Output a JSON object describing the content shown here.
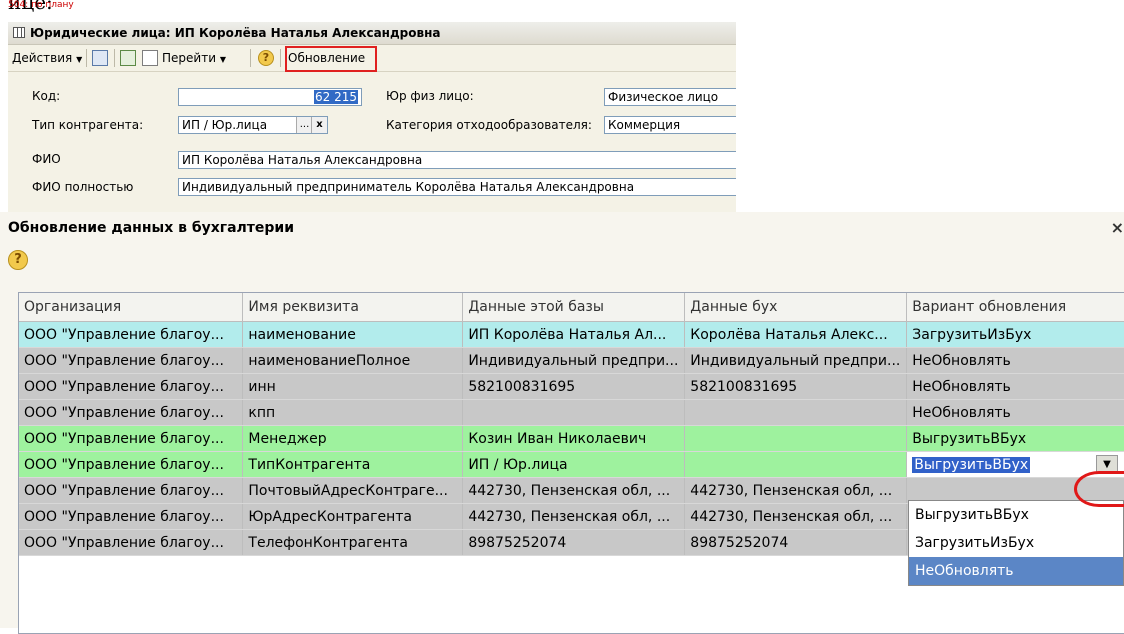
{
  "top": {
    "cropped_text": "ице:",
    "red_text": "504: по плану"
  },
  "window1": {
    "title": "Юридические лица: ИП Королёва Наталья Александровна",
    "toolbar": {
      "actions": "Действия",
      "goto": "Перейти",
      "help": "?",
      "refresh": "Обновление"
    },
    "form": {
      "code_label": "Код:",
      "code_value": "62 215",
      "legal_label": "Юр физ лицо:",
      "legal_value": "Физическое лицо",
      "type_label": "Тип контрагента:",
      "type_value": "ИП / Юр.лица",
      "type_btn1": "...",
      "type_btn2": "x",
      "category_label": "Категория отходообразователя:",
      "category_value": "Коммерция",
      "fio_label": "ФИО",
      "fio_value": "ИП Королёва Наталья Александровна",
      "fio_full_label": "ФИО полностью",
      "fio_full_value": "Индивидуальный предприниматель Королёва Наталья Александровна"
    }
  },
  "window2": {
    "title": "Обновление данных в бухгалтерии",
    "close": "×",
    "help": "?",
    "columns": [
      "Организация",
      "Имя реквизита",
      "Данные этой базы",
      "Данные бух",
      "Вариант обновления"
    ],
    "rows": [
      {
        "org": "ООО \"Управление благоу...",
        "name": "наименование",
        "local": "ИП Королёва Наталья Ал...",
        "buh": "Королёва Наталья Алекс...",
        "variant": "ЗагрузитьИзБух"
      },
      {
        "org": "ООО \"Управление благоу...",
        "name": "наименованиеПолное",
        "local": "Индивидуальный предпри...",
        "buh": "Индивидуальный предпри...",
        "variant": "НеОбновлять"
      },
      {
        "org": "ООО \"Управление благоу...",
        "name": "инн",
        "local": "582100831695",
        "buh": "582100831695",
        "variant": "НеОбновлять"
      },
      {
        "org": "ООО \"Управление благоу...",
        "name": "кпп",
        "local": "",
        "buh": "",
        "variant": "НеОбновлять"
      },
      {
        "org": "ООО \"Управление благоу...",
        "name": "Менеджер",
        "local": "Козин Иван Николаевич",
        "buh": "",
        "variant": "ВыгрузитьВБух"
      },
      {
        "org": "ООО \"Управление благоу...",
        "name": "ТипКонтрагента",
        "local": "ИП / Юр.лица",
        "buh": "",
        "variant": "ВыгрузитьВБух"
      },
      {
        "org": "ООО \"Управление благоу...",
        "name": "ПочтовыйАдресКонтраге...",
        "local": "442730, Пензенская обл, ...",
        "buh": "442730, Пензенская обл, ...",
        "variant": ""
      },
      {
        "org": "ООО \"Управление благоу...",
        "name": "ЮрАдресКонтрагента",
        "local": "442730, Пензенская обл, ...",
        "buh": "442730, Пензенская обл, ...",
        "variant": ""
      },
      {
        "org": "ООО \"Управление благоу...",
        "name": "ТелефонКонтрагента",
        "local": "89875252074",
        "buh": "89875252074",
        "variant": ""
      }
    ],
    "dropdown_options": [
      "ВыгрузитьВБух",
      "ЗагрузитьИзБух",
      "НеОбновлять"
    ],
    "dropdown_selected": "НеОбновлять"
  },
  "colors": {
    "row_cyan": "#b2ecec",
    "row_gray": "#c8c8c8",
    "row_green": "#9ef29e",
    "highlight_red": "#e02020",
    "selection_blue": "#5b86c6"
  }
}
